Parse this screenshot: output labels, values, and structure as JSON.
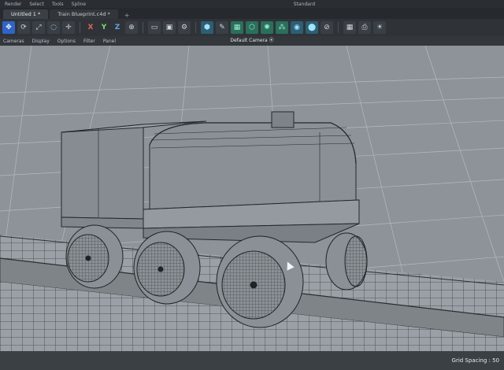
{
  "menubar": {
    "items": [
      "Render",
      "Select",
      "Tools",
      "Spline"
    ],
    "right_item": "Standard"
  },
  "tabs": [
    {
      "label": "Untitled 1 *",
      "active": true
    },
    {
      "label": "Train Blueprint.c4d *",
      "active": false
    }
  ],
  "tab_add": "+",
  "toolbar": {
    "axes": {
      "x": "X",
      "y": "Y",
      "z": "Z"
    }
  },
  "viewmenu": {
    "items": [
      "Cameras",
      "Display",
      "Options",
      "Filter",
      "Panel"
    ]
  },
  "viewport": {
    "camera_label": "Default Camera ⦿",
    "background_color": "#8e9499"
  },
  "statusbar": {
    "grid_spacing": "Grid Spacing : 50"
  },
  "icons": [
    "move-icon",
    "rotate-icon",
    "scale-icon",
    "cube-icon",
    "pen-icon",
    "subdivision-icon",
    "camera-icon",
    "light-icon"
  ]
}
